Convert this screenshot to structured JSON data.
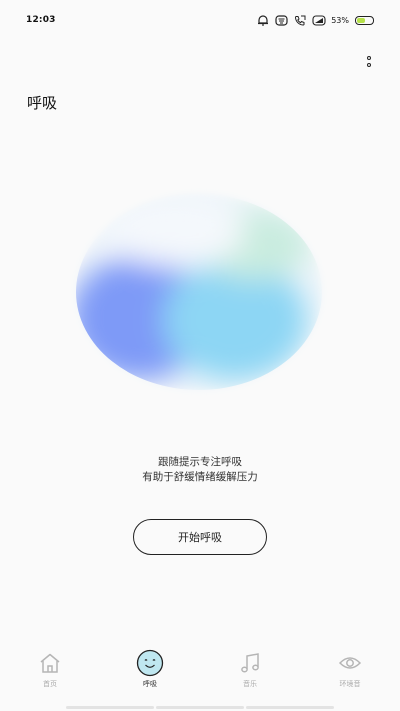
{
  "status_bar": {
    "time": "12:03",
    "battery_percent": "53%",
    "battery_level": 0.53,
    "icons": [
      "alarm-icon",
      "notification-icon",
      "call-icon",
      "signal-icon"
    ]
  },
  "header": {
    "title": "呼吸",
    "more_icon": "more-vertical-icon"
  },
  "main": {
    "orb_colors": {
      "blue": "#7e9af7",
      "cyan": "#8dd6f4",
      "mint": "#c9ecdf"
    },
    "desc_line1": "跟随提示专注呼吸",
    "desc_line2": "有助于舒缓情绪缓解压力",
    "start_label": "开始呼吸"
  },
  "tabs": [
    {
      "label": "首页",
      "icon": "home-icon",
      "active": false
    },
    {
      "label": "呼吸",
      "icon": "smile-icon",
      "active": true
    },
    {
      "label": "音乐",
      "icon": "music-note-icon",
      "active": false
    },
    {
      "label": "环境音",
      "icon": "eye-icon",
      "active": false
    }
  ],
  "colors": {
    "active_tab_bg": "#bfe7f0",
    "inactive": "#aaaaaa"
  }
}
